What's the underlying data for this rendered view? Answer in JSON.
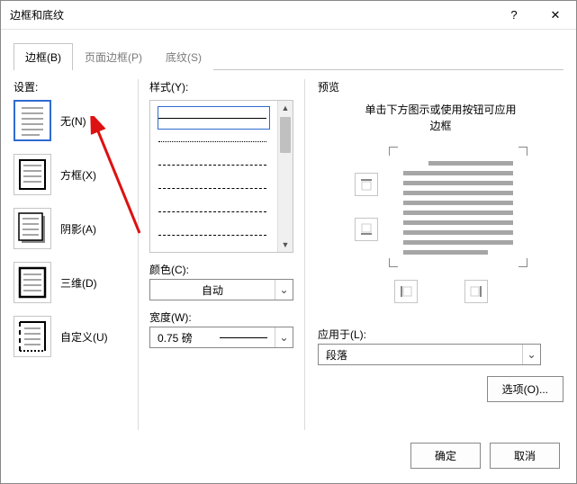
{
  "dialog": {
    "title": "边框和底纹"
  },
  "tabs": {
    "border": "边框(B)",
    "page_border": "页面边框(P)",
    "shading": "底纹(S)"
  },
  "settings": {
    "label": "设置:",
    "none": "无(N)",
    "box": "方框(X)",
    "shadow": "阴影(A)",
    "threeD": "三维(D)",
    "custom": "自定义(U)"
  },
  "style": {
    "label": "样式(Y):",
    "color_label": "颜色(C):",
    "color_value": "自动",
    "width_label": "宽度(W):",
    "width_value": "0.75 磅"
  },
  "preview": {
    "label": "预览",
    "hint1": "单击下方图示或使用按钮可应用",
    "hint2": "边框",
    "apply_label": "应用于(L):",
    "apply_value": "段落",
    "options": "选项(O)..."
  },
  "footer": {
    "ok": "确定",
    "cancel": "取消"
  }
}
